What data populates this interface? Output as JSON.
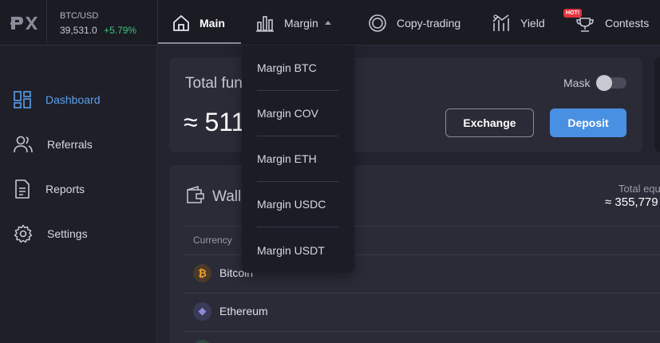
{
  "header": {
    "logo_icon": "px-logo-icon",
    "ticker": {
      "pair": "BTC/USD",
      "price": "39,531.0",
      "change": "+5.79%",
      "change_color": "#3dc27a"
    },
    "nav": [
      {
        "id": "main",
        "label": "Main",
        "icon": "home-icon",
        "active": true
      },
      {
        "id": "margin",
        "label": "Margin",
        "icon": "bar-chart-icon",
        "expanded": true
      },
      {
        "id": "copy",
        "label": "Copy-trading",
        "icon": "copy-trading-icon"
      },
      {
        "id": "yield",
        "label": "Yield",
        "icon": "yield-icon"
      },
      {
        "id": "contests",
        "label": "Contests",
        "icon": "trophy-icon",
        "badge": "HOT!"
      }
    ]
  },
  "margin_menu": {
    "items": [
      {
        "label": "Margin BTC"
      },
      {
        "label": "Margin COV"
      },
      {
        "label": "Margin ETH"
      },
      {
        "label": "Margin USDC"
      },
      {
        "label": "Margin USDT"
      }
    ]
  },
  "sidebar": {
    "items": [
      {
        "label": "Dashboard",
        "icon": "dashboard-icon",
        "active": true
      },
      {
        "label": "Referrals",
        "icon": "users-icon"
      },
      {
        "label": "Reports",
        "icon": "document-icon"
      },
      {
        "label": "Settings",
        "icon": "gear-icon"
      }
    ]
  },
  "funds": {
    "title": "Total fun",
    "value": "≈ 511",
    "mask_label": "Mask",
    "mask_on": false,
    "exchange_label": "Exchange",
    "deposit_label": "Deposit"
  },
  "wallet": {
    "title": "Wall",
    "total_eq_label": "Total equ",
    "total_eq_value": "≈ 355,779",
    "currency_header": "Currency",
    "coins": [
      {
        "name": "Bitcoin",
        "icon": "bitcoin-icon",
        "symbol": "₿"
      },
      {
        "name": "Ethereum",
        "icon": "ethereum-icon",
        "symbol": "◆"
      }
    ]
  },
  "colors": {
    "accent": "#4a90e2",
    "active_nav": "#5aa0ec",
    "background": "#23232f"
  }
}
